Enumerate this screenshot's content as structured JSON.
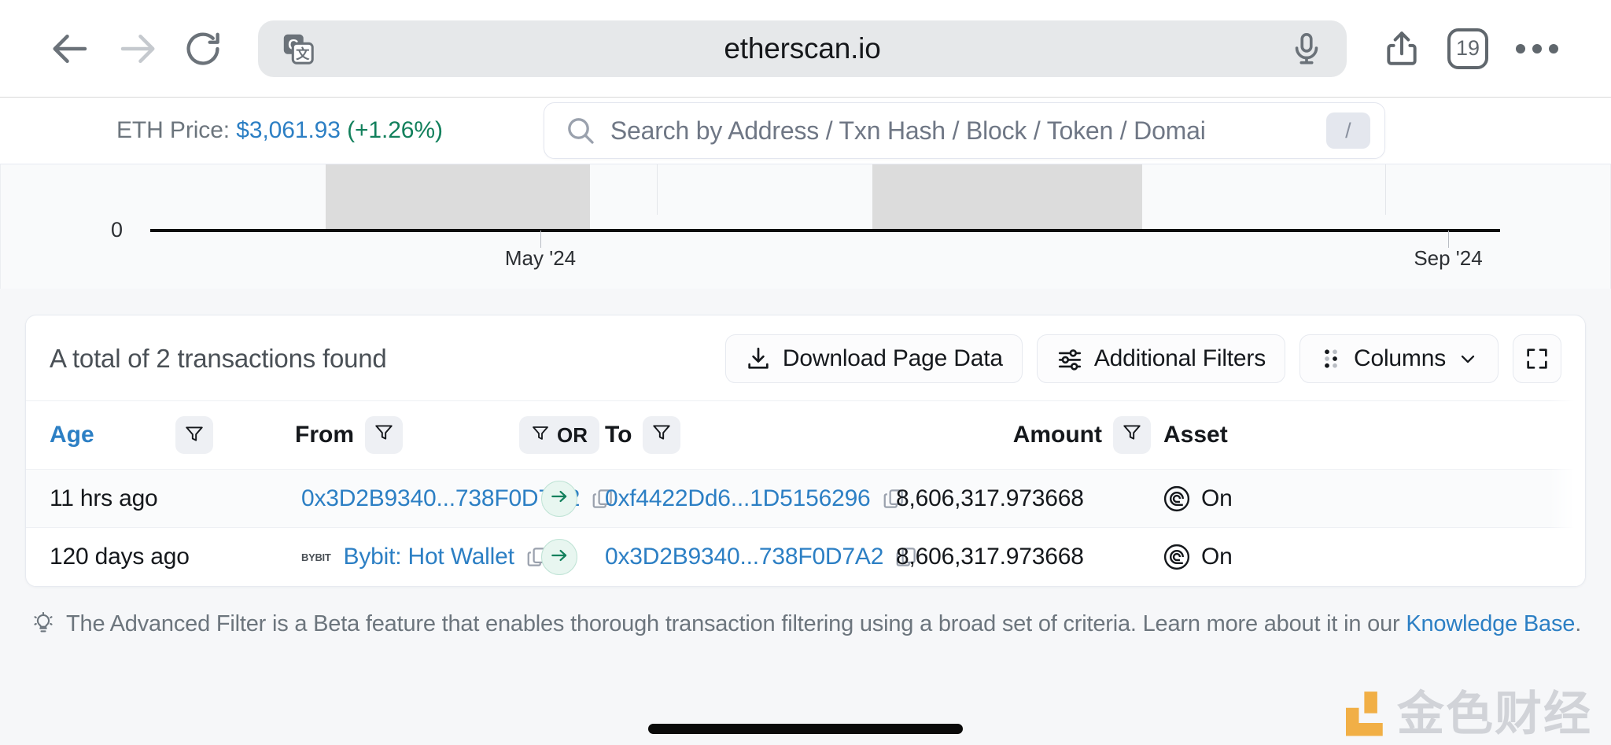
{
  "browser": {
    "back_icon": "arrow-left-icon",
    "forward_icon": "arrow-right-icon",
    "reload_icon": "reload-icon",
    "translate_icon": "translate-icon",
    "url": "etherscan.io",
    "mic_icon": "microphone-icon",
    "share_icon": "share-icon",
    "tab_count": "19",
    "menu_icon": "more-dots-icon"
  },
  "topbar": {
    "eth_price_label": "ETH Price:",
    "eth_price_value": "$3,061.93",
    "eth_price_change": "(+1.26%)",
    "price_color": "#2c7fc4",
    "change_color": "#12805c",
    "search": {
      "icon": "search-icon",
      "placeholder": "Search by Address / Txn Hash / Block / Token / Domai",
      "shortcut": "/"
    }
  },
  "chart_data": {
    "type": "bar",
    "title": "",
    "xlabel": "",
    "ylabel": "",
    "x_tick_labels": [
      "May '24",
      "Sep '24"
    ],
    "y_tick_labels": [
      "0"
    ],
    "ylim": [
      0,
      1
    ],
    "grid": false,
    "legend": null,
    "categories": [
      "May '24",
      "Sep '24"
    ],
    "values": [
      1,
      1
    ],
    "note": "Partially cropped bar chart; two grey bars of equal full height above a zero baseline"
  },
  "panel": {
    "total_label": "A total of 2 transactions found",
    "buttons": {
      "download": {
        "label": "Download Page Data",
        "icon": "download-icon"
      },
      "filters": {
        "label": "Additional Filters",
        "icon": "sliders-icon"
      },
      "columns": {
        "label": "Columns",
        "icon": "grid-dots-icon",
        "chevron": "chevron-down-icon"
      },
      "expand": {
        "label": "",
        "icon": "fullscreen-icon"
      }
    },
    "table": {
      "headers": [
        {
          "label": "Age",
          "sorted": true,
          "filter_icon": "funnel-icon"
        },
        {
          "label": "From",
          "sorted": false,
          "filter_icon": "funnel-icon"
        },
        {
          "label": "OR",
          "sorted": false,
          "filter_icon": "funnel-icon"
        },
        {
          "label": "To",
          "sorted": false,
          "filter_icon": "funnel-icon"
        },
        {
          "label": "Amount",
          "sorted": false,
          "filter_icon": "funnel-icon"
        },
        {
          "label": "Asset",
          "sorted": false,
          "filter_icon": null
        }
      ],
      "rows": [
        {
          "age": "11 hrs ago",
          "from": "0x3D2B9340...738F0D7A2",
          "from_badge": null,
          "direction_icon": "arrow-right-icon",
          "to": "0xf4422Dd6...1D5156296",
          "amount": "8,606,317.973668",
          "asset": "On",
          "asset_icon": "ondo-token-icon"
        },
        {
          "age": "120 days ago",
          "from": "Bybit: Hot Wallet",
          "from_badge": "BYBIT",
          "direction_icon": "arrow-right-icon",
          "to": "0x3D2B9340...738F0D7A2",
          "amount": "8,606,317.973668",
          "asset": "On",
          "asset_icon": "ondo-token-icon"
        }
      ]
    }
  },
  "footer": {
    "icon": "lightbulb-icon",
    "text_before": "The Advanced Filter is a Beta feature that enables thorough transaction filtering using a broad set of criteria. Learn more about it in our ",
    "link": "Knowledge Base",
    "text_after": "."
  },
  "watermark": {
    "text": "金色财经",
    "mark_color": "#f0a020"
  }
}
